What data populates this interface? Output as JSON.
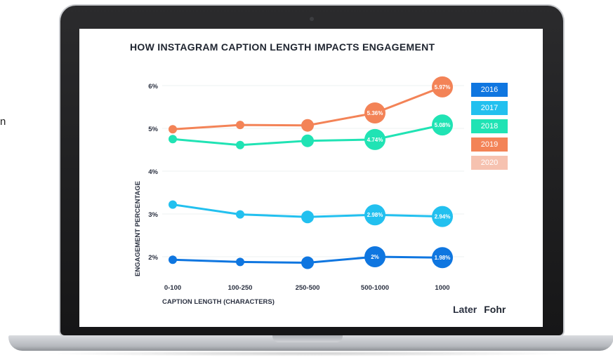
{
  "edge_text": "n",
  "chart_data": {
    "type": "line",
    "title": "HOW INSTAGRAM CAPTION LENGTH IMPACTS ENGAGEMENT",
    "xlabel": "CAPTION LENGTH (CHARACTERS)",
    "ylabel": "ENGAGEMENT PERCENTAGE",
    "categories": [
      "0-100",
      "100-250",
      "250-500",
      "500-1000",
      "1000"
    ],
    "y_ticks": [
      "2%",
      "3%",
      "4%",
      "5%",
      "6%"
    ],
    "ylim": [
      1.8,
      6.2
    ],
    "legend_position": "right",
    "legend": [
      "2016",
      "2017",
      "2018",
      "2019",
      "2020"
    ],
    "legend_colors": [
      "#0f76e0",
      "#22c0ef",
      "#20e3b4",
      "#f38357",
      "#f6c2b0"
    ],
    "series": [
      {
        "name": "2016",
        "color": "#0f76e0",
        "values": [
          1.93,
          1.88,
          1.86,
          2.0,
          1.98
        ],
        "labels": [
          "",
          "",
          "",
          "2%",
          "1.98%"
        ]
      },
      {
        "name": "2017",
        "color": "#22c0ef",
        "values": [
          3.22,
          2.99,
          2.93,
          2.98,
          2.94
        ],
        "labels": [
          "",
          "",
          "",
          "2.98%",
          "2.94%"
        ]
      },
      {
        "name": "2018",
        "color": "#20e3b4",
        "values": [
          4.75,
          4.61,
          4.71,
          4.74,
          5.08
        ],
        "labels": [
          "",
          "",
          "",
          "4.74%",
          "5.08%"
        ]
      },
      {
        "name": "2019",
        "color": "#f38357",
        "values": [
          4.98,
          5.08,
          5.07,
          5.36,
          5.97
        ],
        "labels": [
          "",
          "",
          "",
          "5.36%",
          "5.97%"
        ]
      }
    ]
  },
  "brand": {
    "later": "Later",
    "fohr": "Fohr"
  }
}
